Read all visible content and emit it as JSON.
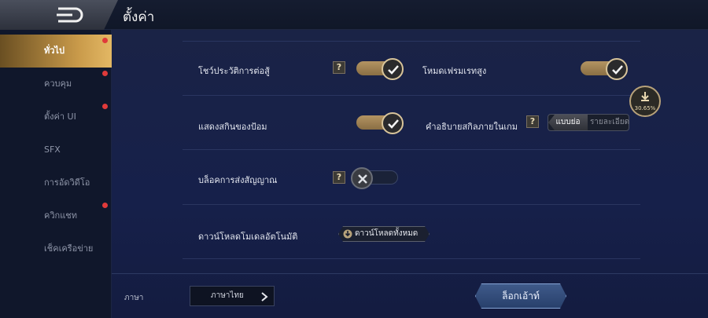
{
  "header": {
    "title": "ตั้งค่า"
  },
  "sidebar": {
    "items": [
      {
        "label": "ทั่วไป",
        "active": true,
        "badge": true
      },
      {
        "label": "ควบคุม",
        "active": false,
        "badge": true
      },
      {
        "label": "ตั้งค่า UI",
        "active": false,
        "badge": true
      },
      {
        "label": "SFX",
        "active": false,
        "badge": false
      },
      {
        "label": "การอัดวิดีโอ",
        "active": false,
        "badge": false
      },
      {
        "label": "ควิกแชท",
        "active": false,
        "badge": true
      },
      {
        "label": "เช็คเครือข่าย",
        "active": false,
        "badge": false
      }
    ]
  },
  "settings": {
    "show_battle_history": {
      "label": "โชว์ประวัติการต่อสู้",
      "help": "?",
      "value": true
    },
    "high_frame_mode": {
      "label": "โหมดเฟรมเรทสูง",
      "value": true
    },
    "show_tower_skin": {
      "label": "แสดงสกินของป้อม",
      "value": true
    },
    "skill_description": {
      "label": "คำอธิบายสกิลภายในเกม",
      "help": "?",
      "options": [
        "แบบย่อ",
        "รายละเอียด"
      ],
      "selected": "แบบย่อ"
    },
    "skill_download": {
      "progress_text": "30.65%",
      "progress": 0.3065
    },
    "block_signals": {
      "label": "บล็อคการส่งสัญญาณ",
      "help": "?",
      "value": false
    },
    "auto_download_model": {
      "label": "ดาวน์โหลดโมเดลอัตโนมัติ",
      "button": "ดาวน์โหลดทั้งหมด"
    }
  },
  "footer": {
    "language_label": "ภาษา",
    "language_value": "ภาษาไทย",
    "logout_label": "ล็อกเอ้าท์"
  },
  "colors": {
    "accent": "#c99a4a",
    "badge": "#e03a3a"
  }
}
